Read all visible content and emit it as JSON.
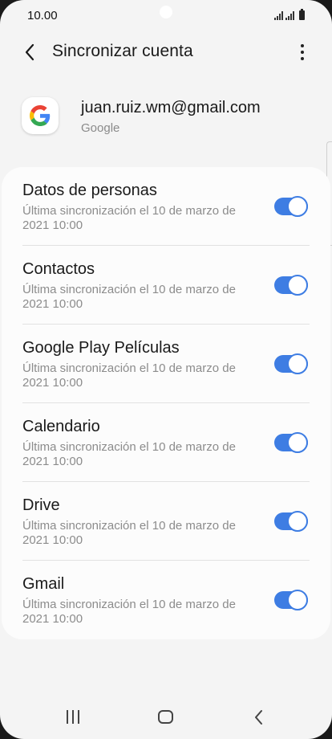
{
  "status_bar": {
    "time": "10.00"
  },
  "header": {
    "title": "Sincronizar cuenta",
    "back_icon": "back-arrow-icon",
    "more_icon": "more-vertical-icon"
  },
  "account": {
    "email": "juan.ruiz.wm@gmail.com",
    "type": "Google",
    "logo_icon": "google-logo-icon"
  },
  "sync_items": [
    {
      "title": "Datos de personas",
      "subtitle": "Última sincronización el 10 de marzo de 2021 10:00",
      "enabled": true
    },
    {
      "title": "Contactos",
      "subtitle": "Última sincronización el 10 de marzo de 2021 10:00",
      "enabled": true
    },
    {
      "title": "Google Play Películas",
      "subtitle": "Última sincronización el 10 de marzo de 2021 10:00",
      "enabled": true
    },
    {
      "title": "Calendario",
      "subtitle": "Última sincronización el 10 de marzo de 2021 10:00",
      "enabled": true
    },
    {
      "title": "Drive",
      "subtitle": "Última sincronización el 10 de marzo de 2021 10:00",
      "enabled": true
    },
    {
      "title": "Gmail",
      "subtitle": "Última sincronización el 10 de marzo de 2021 10:00",
      "enabled": true
    }
  ],
  "nav_bar": {
    "recents_icon": "recents-icon",
    "home_icon": "home-icon",
    "back_icon": "nav-back-icon"
  },
  "colors": {
    "accent": "#3e7de3",
    "background": "#f4f4f4",
    "card": "#fcfcfc"
  }
}
